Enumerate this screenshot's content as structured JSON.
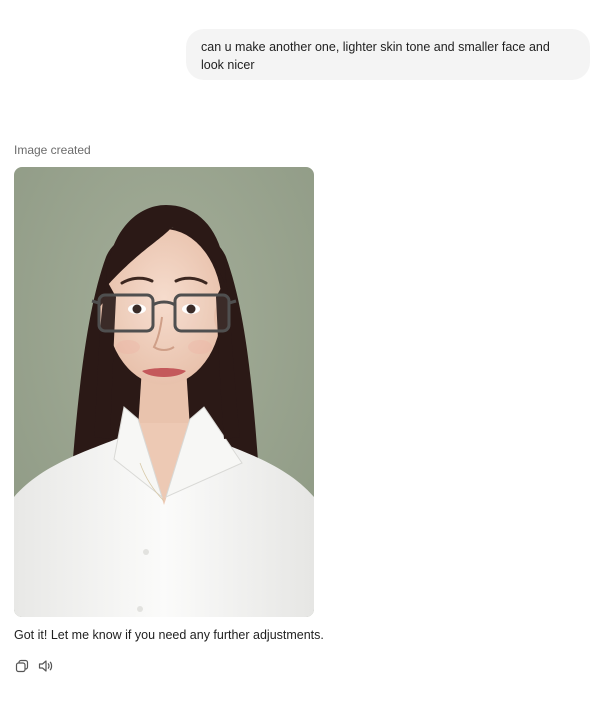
{
  "user_message": {
    "text": "can u make another one, lighter skin tone and smaller face and look nicer"
  },
  "assistant": {
    "status_label": "Image created",
    "image": {
      "subject": "portrait of a woman with long dark hair, rectangular glasses, white collared shirt, sage green background",
      "background_color": "#9aa58f",
      "shirt_color": "#f4f4f2",
      "hair_color": "#2b1916",
      "skin_color": "#f1d3c3"
    },
    "reply_text": "Got it! Let me know if you need any further adjustments.",
    "actions": [
      {
        "icon": "copy-icon"
      },
      {
        "icon": "speaker-icon"
      }
    ]
  }
}
